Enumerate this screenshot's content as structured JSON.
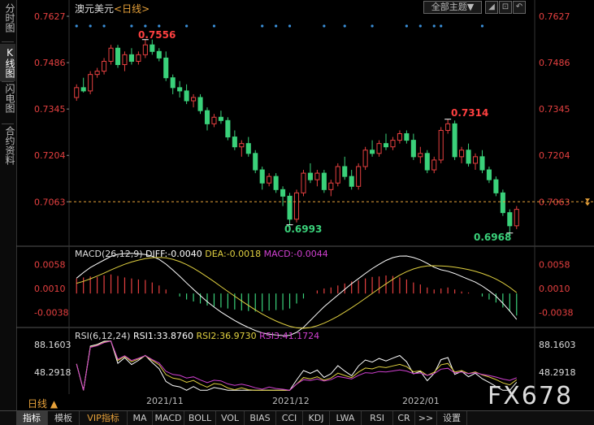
{
  "window": {
    "title": "澳元美元",
    "subtitle": "<日线>",
    "theme_button": "全部主题▼",
    "win_buttons": [
      "◢",
      "⊡",
      "↶"
    ]
  },
  "side_tabs": [
    {
      "label": "分时图",
      "active": false
    },
    {
      "label": "K线图",
      "active": true
    },
    {
      "label": "闪电图",
      "active": false
    },
    {
      "label": "合约资料",
      "active": false
    }
  ],
  "price_axis": [
    "0.7627",
    "0.7486",
    "0.7345",
    "0.7204",
    "0.7063"
  ],
  "current_price": "0.7063",
  "annotations": {
    "high1": "0.7556",
    "high2": "0.7314",
    "low1": "0.6993",
    "low2": "0.6968"
  },
  "macd": {
    "label": "MACD(26,12,9)",
    "diff": "DIFF:-0.0040",
    "dea": "DEA:-0.0018",
    "macd": "MACD:-0.0044",
    "axis": [
      "0.0058",
      "0.0010",
      "-0.0038"
    ]
  },
  "rsi": {
    "label": "RSI(6,12,24)",
    "rsi1": "RSI1:33.8760",
    "rsi2": "RSI2:36.9730",
    "rsi3": "RSI3:41.1724",
    "axis": [
      "88.1603",
      "48.2918"
    ]
  },
  "x_axis": [
    "2021/11",
    "2021/12",
    "2022/01"
  ],
  "period_label": "日线 ▲",
  "bottom_tabs": [
    "指标",
    "模板",
    "VIP指标",
    "MA",
    "MACD",
    "BOLL",
    "VOL",
    "BIAS",
    "CCI",
    "KDJ",
    "LWA",
    "RSI",
    "CR",
    ">>",
    "设置"
  ],
  "watermark": "FX678",
  "colors": {
    "up": "#e64040",
    "down": "#3ad17a",
    "diff": "#ffffff",
    "dea": "#e0d040",
    "rsi3": "#d040d0",
    "accent": "#e8a23a"
  },
  "chart_data": {
    "type": "candlestick",
    "candles": [
      [
        0.738,
        0.742,
        0.737,
        0.741
      ],
      [
        0.741,
        0.744,
        0.7395,
        0.74
      ],
      [
        0.74,
        0.746,
        0.739,
        0.745
      ],
      [
        0.745,
        0.747,
        0.744,
        0.746
      ],
      [
        0.746,
        0.75,
        0.745,
        0.749
      ],
      [
        0.749,
        0.754,
        0.748,
        0.753
      ],
      [
        0.753,
        0.754,
        0.747,
        0.748
      ],
      [
        0.748,
        0.752,
        0.746,
        0.751
      ],
      [
        0.751,
        0.753,
        0.748,
        0.749
      ],
      [
        0.749,
        0.752,
        0.748,
        0.751
      ],
      [
        0.751,
        0.7556,
        0.75,
        0.754
      ],
      [
        0.754,
        0.7556,
        0.751,
        0.752
      ],
      [
        0.752,
        0.753,
        0.749,
        0.75
      ],
      [
        0.75,
        0.752,
        0.743,
        0.744
      ],
      [
        0.744,
        0.745,
        0.739,
        0.741
      ],
      [
        0.741,
        0.743,
        0.738,
        0.74
      ],
      [
        0.74,
        0.742,
        0.736,
        0.737
      ],
      [
        0.737,
        0.739,
        0.735,
        0.738
      ],
      [
        0.738,
        0.739,
        0.733,
        0.734
      ],
      [
        0.734,
        0.735,
        0.728,
        0.73
      ],
      [
        0.73,
        0.733,
        0.729,
        0.732
      ],
      [
        0.732,
        0.734,
        0.73,
        0.731
      ],
      [
        0.731,
        0.732,
        0.725,
        0.726
      ],
      [
        0.726,
        0.728,
        0.722,
        0.723
      ],
      [
        0.723,
        0.725,
        0.72,
        0.724
      ],
      [
        0.724,
        0.726,
        0.72,
        0.721
      ],
      [
        0.721,
        0.722,
        0.715,
        0.716
      ],
      [
        0.716,
        0.717,
        0.71,
        0.712
      ],
      [
        0.712,
        0.715,
        0.711,
        0.714
      ],
      [
        0.714,
        0.715,
        0.709,
        0.71
      ],
      [
        0.71,
        0.711,
        0.705,
        0.708
      ],
      [
        0.708,
        0.709,
        0.6993,
        0.701
      ],
      [
        0.701,
        0.71,
        0.7,
        0.709
      ],
      [
        0.709,
        0.716,
        0.708,
        0.715
      ],
      [
        0.715,
        0.718,
        0.712,
        0.713
      ],
      [
        0.713,
        0.716,
        0.711,
        0.715
      ],
      [
        0.715,
        0.716,
        0.709,
        0.71
      ],
      [
        0.71,
        0.713,
        0.708,
        0.712
      ],
      [
        0.712,
        0.718,
        0.711,
        0.717
      ],
      [
        0.717,
        0.72,
        0.713,
        0.714
      ],
      [
        0.714,
        0.716,
        0.71,
        0.711
      ],
      [
        0.711,
        0.718,
        0.71,
        0.717
      ],
      [
        0.717,
        0.723,
        0.716,
        0.722
      ],
      [
        0.722,
        0.725,
        0.72,
        0.721
      ],
      [
        0.721,
        0.725,
        0.72,
        0.724
      ],
      [
        0.724,
        0.727,
        0.722,
        0.723
      ],
      [
        0.723,
        0.726,
        0.722,
        0.725
      ],
      [
        0.725,
        0.728,
        0.724,
        0.727
      ],
      [
        0.727,
        0.728,
        0.724,
        0.725
      ],
      [
        0.725,
        0.727,
        0.719,
        0.72
      ],
      [
        0.72,
        0.723,
        0.718,
        0.721
      ],
      [
        0.721,
        0.722,
        0.715,
        0.716
      ],
      [
        0.716,
        0.72,
        0.715,
        0.719
      ],
      [
        0.719,
        0.729,
        0.718,
        0.728
      ],
      [
        0.728,
        0.7314,
        0.727,
        0.73
      ],
      [
        0.73,
        0.731,
        0.719,
        0.72
      ],
      [
        0.72,
        0.723,
        0.718,
        0.722
      ],
      [
        0.722,
        0.724,
        0.717,
        0.718
      ],
      [
        0.718,
        0.721,
        0.716,
        0.72
      ],
      [
        0.72,
        0.722,
        0.715,
        0.716
      ],
      [
        0.716,
        0.717,
        0.712,
        0.713
      ],
      [
        0.713,
        0.714,
        0.708,
        0.709
      ],
      [
        0.709,
        0.71,
        0.702,
        0.703
      ],
      [
        0.703,
        0.704,
        0.6968,
        0.699
      ],
      [
        0.699,
        0.705,
        0.698,
        0.704
      ]
    ],
    "y_range": [
      0.696,
      0.7627
    ],
    "macd_hist": [
      0.003,
      0.0032,
      0.0034,
      0.0033,
      0.0036,
      0.0038,
      0.0035,
      0.0032,
      0.003,
      0.0028,
      0.0027,
      0.0022,
      0.0016,
      0.0008,
      0.0,
      -0.0006,
      -0.0012,
      -0.0016,
      -0.002,
      -0.0024,
      -0.0026,
      -0.0028,
      -0.003,
      -0.0032,
      -0.0034,
      -0.0035,
      -0.0036,
      -0.0036,
      -0.0034,
      -0.0033,
      -0.0033,
      -0.003,
      -0.002,
      -0.001,
      0.0,
      0.0006,
      0.001,
      0.0012,
      0.0016,
      0.002,
      0.0024,
      0.0026,
      0.003,
      0.0033,
      0.0034,
      0.0036,
      0.0035,
      0.0032,
      0.0028,
      0.0022,
      0.0018,
      0.0012,
      0.0008,
      0.001,
      0.0012,
      0.0008,
      0.0004,
      0.0002,
      0.0,
      -0.0006,
      -0.0012,
      -0.0018,
      -0.0028,
      -0.0036,
      -0.0044
    ],
    "macd_range": [
      -0.005,
      0.007
    ],
    "rsi_range": [
      20,
      95
    ]
  }
}
